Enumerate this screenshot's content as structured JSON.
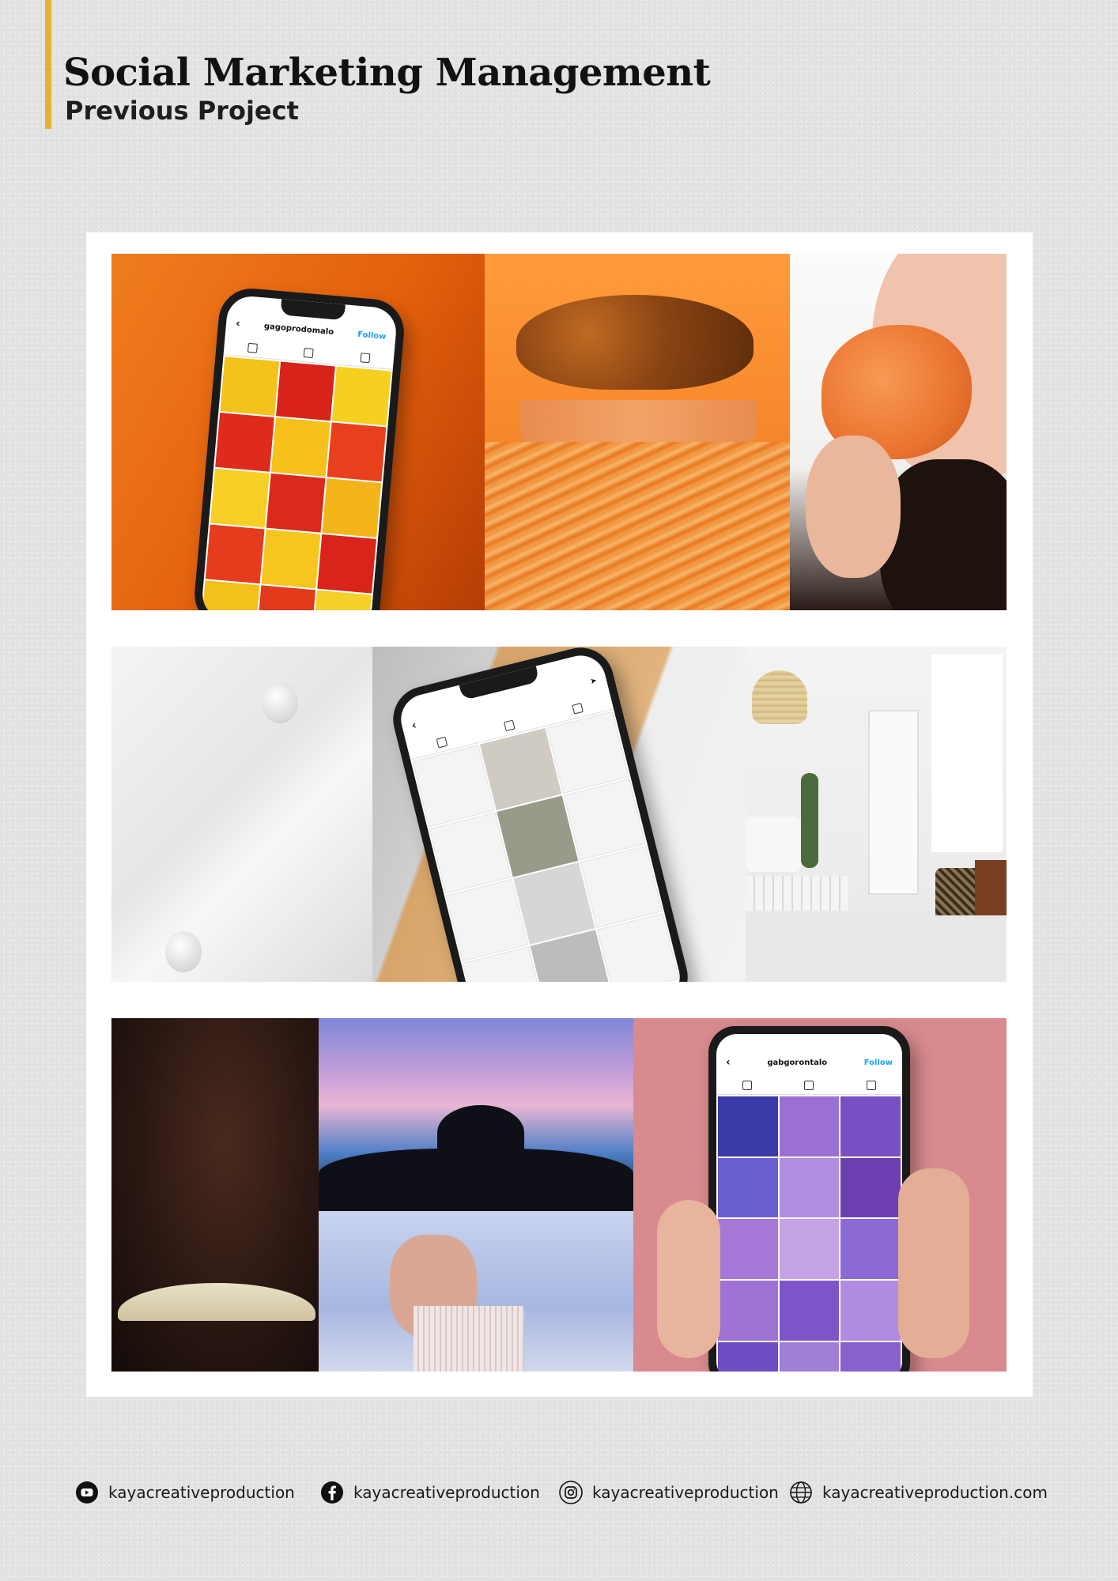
{
  "header": {
    "title": "Social Marketing Management",
    "subtitle": "Previous Project"
  },
  "footer": {
    "youtube": "kayacreativeproduction",
    "facebook": "kayacreativeproduction",
    "instagram": "kayacreativeproduction",
    "website": "kayacreativeproduction.com"
  },
  "phones": {
    "food_account": "gagoprodomalo",
    "church_account": "gabgorontalo",
    "follow_label": "Follow"
  },
  "colors": {
    "accent_bar": "#e3b234",
    "food_orange": "#e86a12",
    "church_pink": "#d88a8e",
    "instagram_follow_blue": "#1da1f2"
  }
}
